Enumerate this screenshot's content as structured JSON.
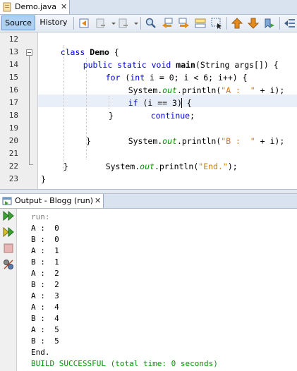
{
  "editor_tab": {
    "label": "Demo.java",
    "close": "✕"
  },
  "toolbar": {
    "source_label": "Source",
    "history_label": "History"
  },
  "line_numbers": [
    "12",
    "13",
    "14",
    "15",
    "16",
    "17",
    "18",
    "19",
    "20",
    "21",
    "22",
    "23"
  ],
  "code": {
    "l12": {
      "kw": "class",
      "name": "Demo",
      "rest": " {"
    },
    "l13": {
      "kw": "public static void",
      "method": "main",
      "rest": "(String args[]) {"
    },
    "l14": {
      "kw1": "for",
      "p1": " (",
      "kw2": "int",
      "rest": " i = 0; i < 6; i++) {"
    },
    "l15": {
      "a": "System.",
      "field": "out",
      "b": ".println(",
      "str": "\"A :  \"",
      "c": " + i);"
    },
    "l16": {
      "kw": "if",
      "rest": " (i == 3) {"
    },
    "l17": {
      "kw": "continue",
      "rest": ";"
    },
    "l18": {
      "text": "}"
    },
    "l19": {
      "a": "System.",
      "field": "out",
      "b": ".println(",
      "str": "\"B :  \"",
      "c": " + i);"
    },
    "l20": {
      "text": "}"
    },
    "l21": {
      "a": "System.",
      "field": "out",
      "b": ".println(",
      "str": "\"End.\"",
      "c": ");"
    },
    "l22": {
      "text": "}"
    },
    "l23": {
      "text": "}"
    }
  },
  "output_tab": {
    "label": "Output - Blogg (run)",
    "close": "✕"
  },
  "output_lines": [
    "run:",
    "A :  0",
    "B :  0",
    "A :  1",
    "B :  1",
    "A :  2",
    "B :  2",
    "A :  3",
    "A :  4",
    "B :  4",
    "A :  5",
    "B :  5",
    "End.",
    "BUILD SUCCESSFUL (total time: 0 seconds)"
  ],
  "icons": {
    "toolbar": [
      "last-edit-icon",
      "back-icon",
      "forward-icon",
      "find-icon",
      "find-previous-icon",
      "find-next-icon",
      "toggle-highlight-icon",
      "toggle-rect-selection-icon",
      "previous-bookmark-icon",
      "next-bookmark-icon",
      "toggle-bookmark-icon",
      "shift-left-icon"
    ],
    "output_side": [
      "rerun-icon",
      "rerun-with-options-icon",
      "stop-icon",
      "settings-icon"
    ]
  },
  "colors": {
    "keyword": "#0000e6",
    "string": "#ce7b00",
    "field": "#009900",
    "success": "#009900",
    "selection_tab": "#aed0f2"
  }
}
